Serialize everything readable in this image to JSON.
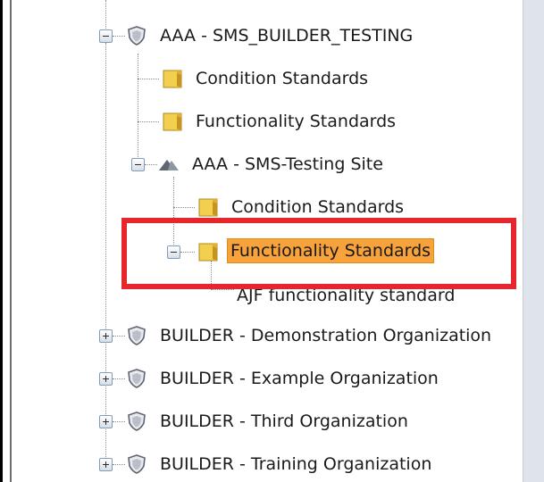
{
  "tree": {
    "nodes": [
      {
        "label": "AAA - SMS_BUILDER_TESTING",
        "icon": "shield-icon",
        "expander": "minus"
      },
      {
        "label": "Condition Standards",
        "icon": "folder-icon"
      },
      {
        "label": "Functionality Standards",
        "icon": "folder-icon"
      },
      {
        "label": "AAA - SMS-Testing Site",
        "icon": "site-icon",
        "expander": "minus"
      },
      {
        "label": "Condition Standards",
        "icon": "folder-icon"
      },
      {
        "label": "Functionality Standards",
        "icon": "folder-icon",
        "expander": "minus",
        "selected": true
      },
      {
        "label": "AJF functionality standard"
      },
      {
        "label": "BUILDER - Demonstration Organization",
        "icon": "shield-icon",
        "expander": "plus"
      },
      {
        "label": "BUILDER - Example Organization",
        "icon": "shield-icon",
        "expander": "plus"
      },
      {
        "label": "BUILDER - Third Organization",
        "icon": "shield-icon",
        "expander": "plus"
      },
      {
        "label": "BUILDER - Training Organization",
        "icon": "shield-icon",
        "expander": "plus"
      }
    ]
  },
  "colors": {
    "selection": "#f7a23a",
    "highlight_border": "#e5262d",
    "folder": "#f2cf4e"
  }
}
